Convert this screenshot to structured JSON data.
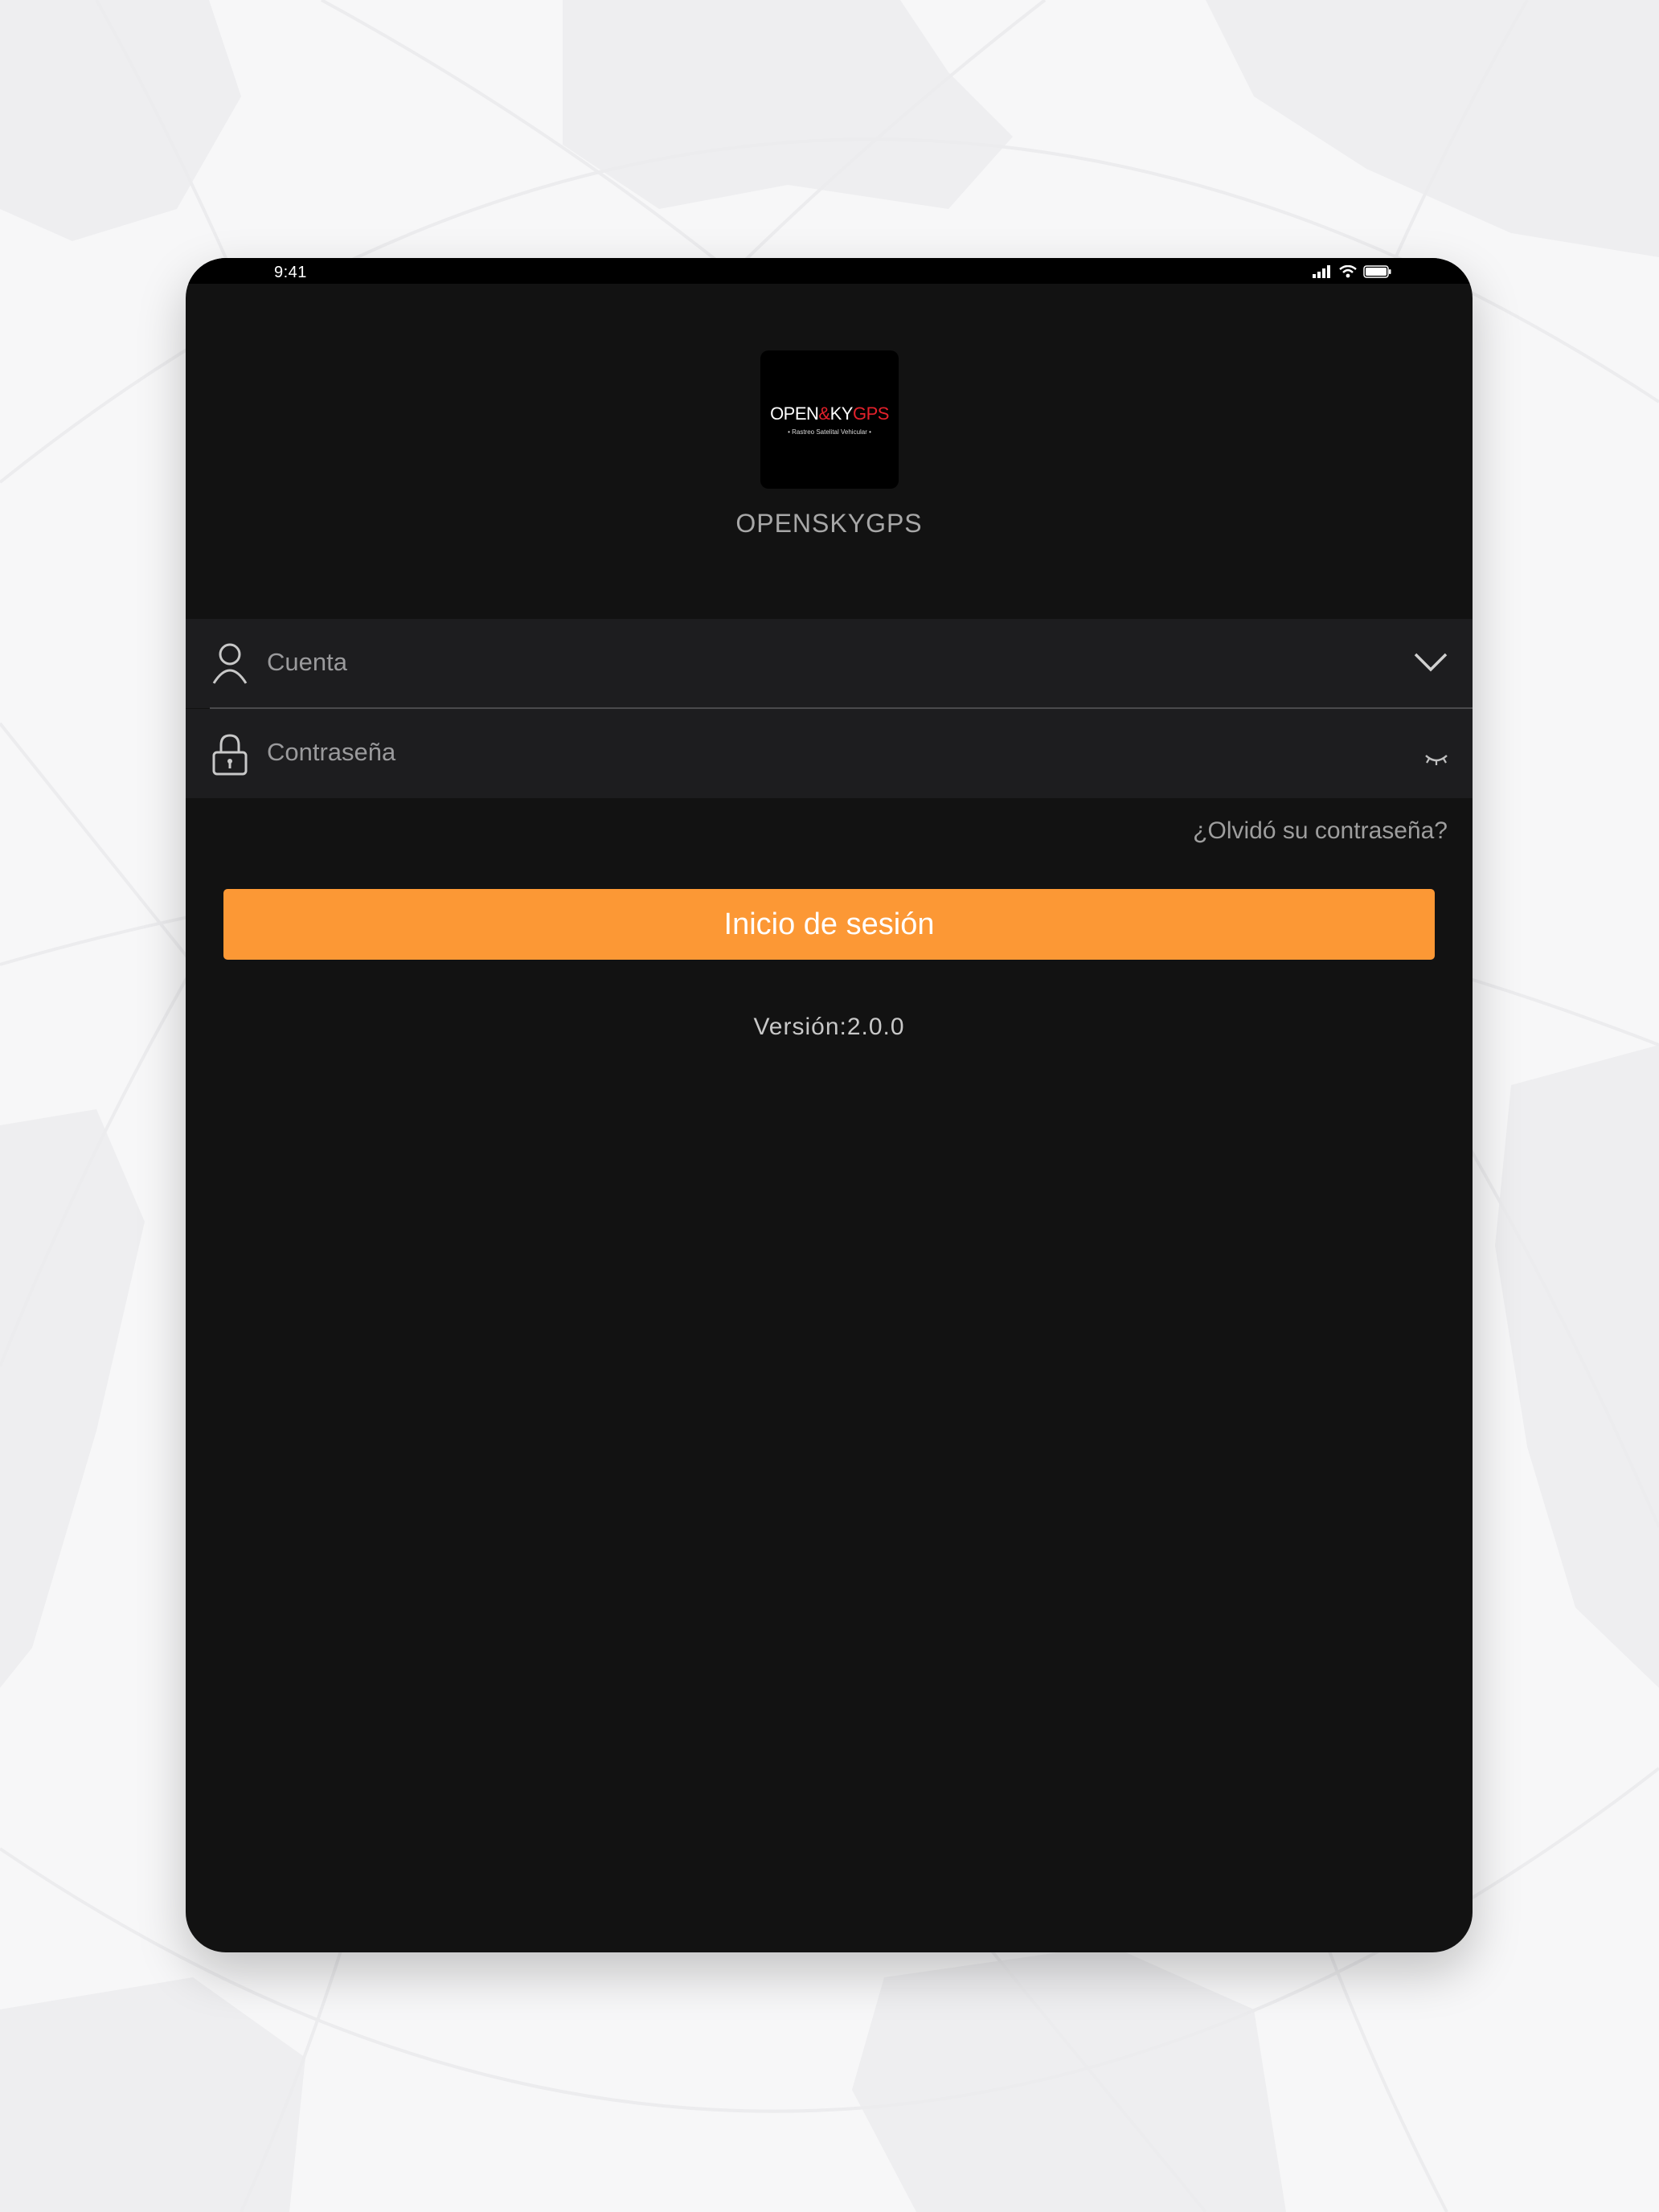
{
  "status_bar": {
    "time": "9:41"
  },
  "header": {
    "logo_text_white": "OPEN",
    "logo_text_ampersand": "&",
    "logo_text_white_2": "KY",
    "logo_text_red": "GPS",
    "logo_tagline": "• Rastreo Satelital Vehicular •",
    "app_name": "OPENSKYGPS"
  },
  "form": {
    "account_placeholder": "Cuenta",
    "password_placeholder": "Contraseña",
    "forgot_password": "¿Olvidó su contraseña?",
    "login_label": "Inicio de sesión"
  },
  "footer": {
    "version": "Versión:2.0.0"
  },
  "colors": {
    "accent": "#fc9835",
    "background": "#121212",
    "field_background": "#1d1d1f",
    "logo_red": "#e3212b"
  },
  "icons": {
    "account": "user-icon",
    "password": "lock-icon",
    "dropdown": "chevron-down-icon",
    "visibility": "eye-closed-icon"
  }
}
